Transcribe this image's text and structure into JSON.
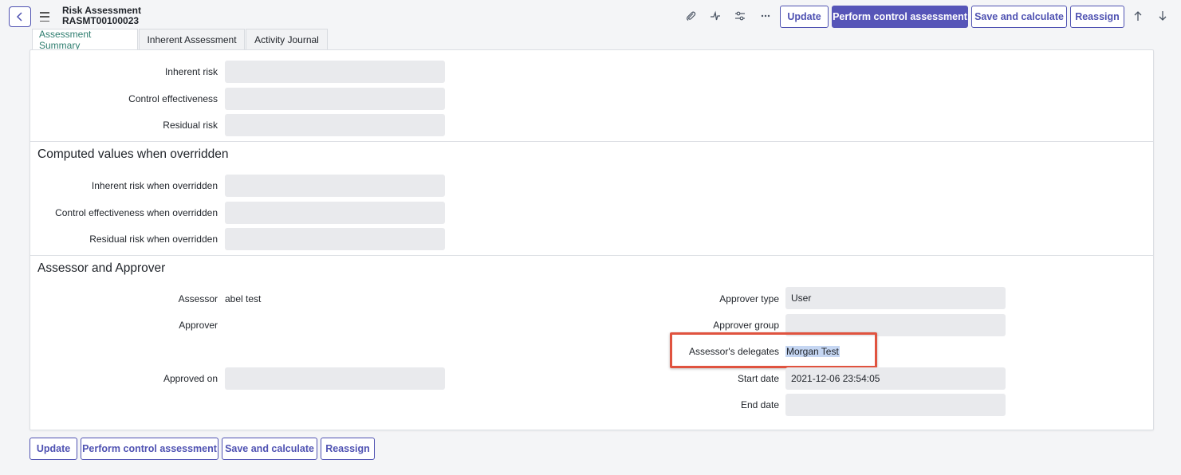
{
  "header": {
    "title": "Risk Assessment",
    "record_number": "RASMT00100023",
    "buttons": {
      "update": "Update",
      "perform": "Perform control assessment",
      "save_calc": "Save and calculate",
      "reassign": "Reassign"
    },
    "icons": [
      "back-icon",
      "menu-icon",
      "attachment-icon",
      "activity-icon",
      "settings-icon",
      "more-icon",
      "up-arrow-icon",
      "down-arrow-icon"
    ]
  },
  "tabs": [
    {
      "label": "Assessment Summary",
      "active": true
    },
    {
      "label": "Inherent Assessment",
      "active": false
    },
    {
      "label": "Activity Journal",
      "active": false
    }
  ],
  "summary": {
    "inherent_risk_label": "Inherent risk",
    "control_effectiveness_label": "Control effectiveness",
    "residual_risk_label": "Residual risk"
  },
  "computed": {
    "title": "Computed values when overridden",
    "inherent_label": "Inherent risk when overridden",
    "control_label": "Control effectiveness when overridden",
    "residual_label": "Residual risk when overridden"
  },
  "assessor": {
    "title": "Assessor and Approver",
    "assessor_label": "Assessor",
    "assessor_value": "abel test",
    "approver_label": "Approver",
    "approved_on_label": "Approved on",
    "approver_type_label": "Approver type",
    "approver_type_value": "User",
    "approver_group_label": "Approver group",
    "delegates_label": "Assessor's delegates",
    "delegates_value": "Morgan Test",
    "start_date_label": "Start date",
    "start_date_value": "2021-12-06 23:54:05",
    "end_date_label": "End date"
  },
  "footer": {
    "update": "Update",
    "perform": "Perform control assessment",
    "save_calc": "Save and calculate",
    "reassign": "Reassign"
  },
  "colors": {
    "accent": "#5655b8",
    "active_tab": "#2e7d6f",
    "highlight": "#e0533f",
    "field_bg": "#e9eaed"
  }
}
